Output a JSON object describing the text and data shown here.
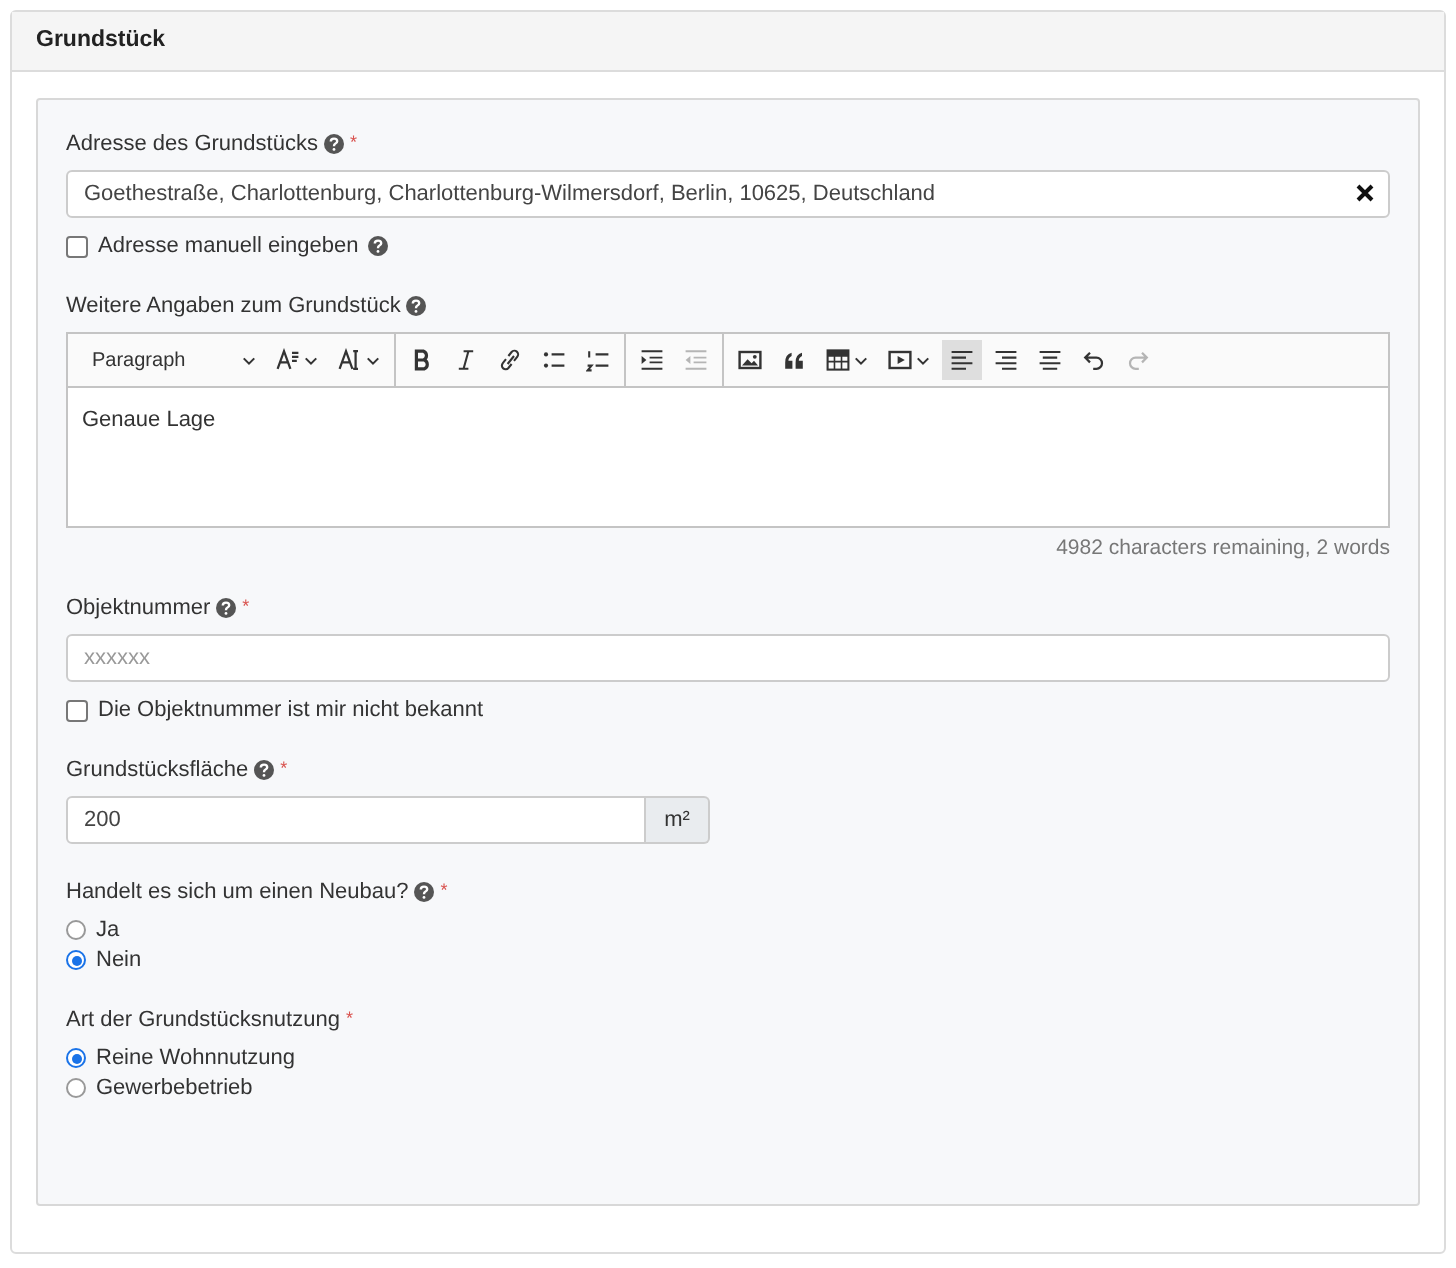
{
  "card": {
    "title": "Grundstück"
  },
  "address": {
    "label": "Adresse des Grundstücks",
    "help": true,
    "required": "*",
    "value": "Goethestraße, Charlottenburg, Charlottenburg-Wilmersdorf, Berlin, 10625, Deutschland",
    "clearable": true
  },
  "manual_address": {
    "label": "Adresse manuell eingeben",
    "help": true,
    "checked": false
  },
  "details": {
    "label": "Weitere Angaben zum Grundstück",
    "help": true,
    "toolbar": [
      [
        {
          "kind": "heading",
          "text": "Paragraph",
          "dropdown": true,
          "active": false,
          "disabled": false
        },
        {
          "kind": "font-size",
          "dropdown": true,
          "active": false,
          "disabled": false
        },
        {
          "kind": "font-family",
          "dropdown": true,
          "active": false,
          "disabled": false
        }
      ],
      [
        {
          "kind": "bold",
          "dropdown": false,
          "active": false,
          "disabled": false
        },
        {
          "kind": "italic",
          "dropdown": false,
          "active": false,
          "disabled": false
        },
        {
          "kind": "link",
          "dropdown": false,
          "active": false,
          "disabled": false
        },
        {
          "kind": "bullets",
          "dropdown": false,
          "active": false,
          "disabled": false
        },
        {
          "kind": "numbers",
          "dropdown": false,
          "active": false,
          "disabled": false
        }
      ],
      [
        {
          "kind": "indent",
          "dropdown": false,
          "active": false,
          "disabled": false
        },
        {
          "kind": "outdent",
          "dropdown": false,
          "active": false,
          "disabled": true
        }
      ],
      [
        {
          "kind": "image",
          "dropdown": false,
          "active": false,
          "disabled": false
        },
        {
          "kind": "quote",
          "dropdown": false,
          "active": false,
          "disabled": false
        },
        {
          "kind": "table",
          "dropdown": true,
          "active": false,
          "disabled": false
        },
        {
          "kind": "media",
          "dropdown": true,
          "active": false,
          "disabled": false
        },
        {
          "kind": "align-left",
          "dropdown": false,
          "active": true,
          "disabled": false
        },
        {
          "kind": "align-right",
          "dropdown": false,
          "active": false,
          "disabled": false
        },
        {
          "kind": "align-center",
          "dropdown": false,
          "active": false,
          "disabled": false
        },
        {
          "kind": "undo",
          "dropdown": false,
          "active": false,
          "disabled": false
        },
        {
          "kind": "redo",
          "dropdown": false,
          "active": false,
          "disabled": true
        }
      ]
    ],
    "content": "Genaue Lage",
    "counter": "4982 characters remaining, 2 words"
  },
  "object_number": {
    "label": "Objektnummer",
    "help": true,
    "required": "*",
    "placeholder": "xxxxxx"
  },
  "object_unknown": {
    "label": "Die Objektnummer ist mir nicht bekannt",
    "checked": false
  },
  "area": {
    "label": "Grundstücksfläche",
    "help": true,
    "required": "*",
    "value": "200",
    "unit": "m²"
  },
  "new_build": {
    "label": "Handelt es sich um einen Neubau?",
    "help": true,
    "required": "*",
    "options": [
      {
        "label": "Ja",
        "selected": false
      },
      {
        "label": "Nein",
        "selected": true
      }
    ]
  },
  "usage": {
    "label": "Art der Grundstücksnutzung",
    "required": "*",
    "options": [
      {
        "label": "Reine Wohnnutzung",
        "selected": true
      },
      {
        "label": "Gewerbebetrieb",
        "selected": false
      }
    ]
  }
}
